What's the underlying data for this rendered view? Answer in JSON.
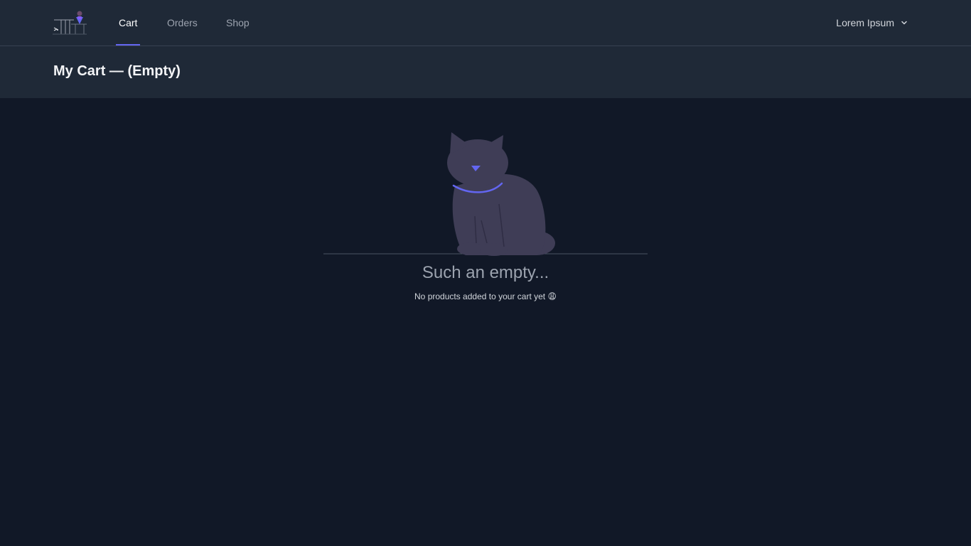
{
  "nav": {
    "tabs": [
      {
        "label": "Cart",
        "active": true
      },
      {
        "label": "Orders",
        "active": false
      },
      {
        "label": "Shop",
        "active": false
      }
    ],
    "user_name": "Lorem Ipsum",
    "user_menu_icon": "chevron-down-icon"
  },
  "header": {
    "title": "My Cart — (Empty)"
  },
  "empty_state": {
    "illustration": "cat-icon",
    "title": "Such an empty...",
    "subtitle": "No products added to your cart yet 😩"
  },
  "colors": {
    "background": "#111827",
    "surface": "#1f2937",
    "accent": "#6366f1",
    "cat": "#3f3d56"
  }
}
